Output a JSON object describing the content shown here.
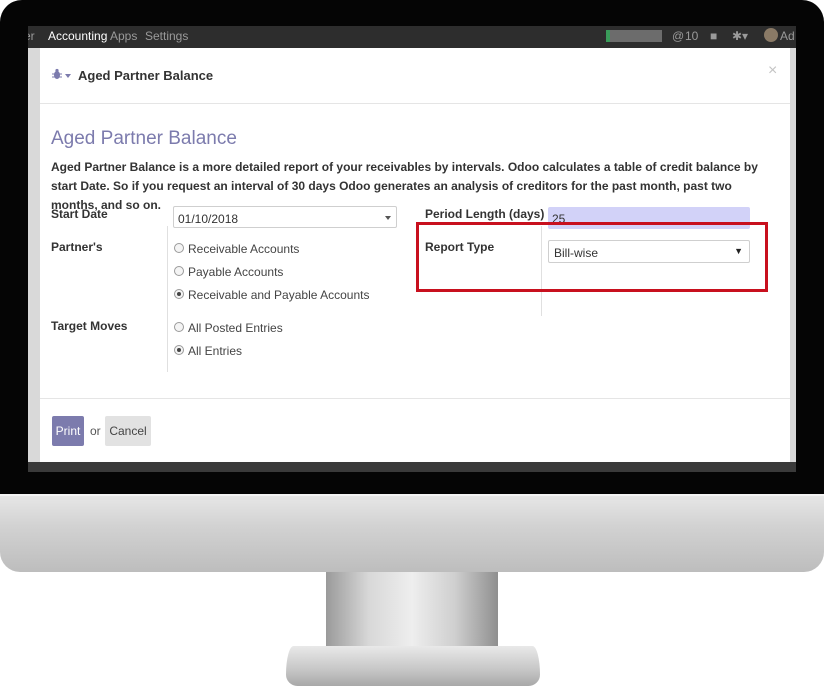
{
  "topbar": {
    "items": [
      "er",
      "Accounting",
      "Apps",
      "Settings"
    ],
    "message_count": "10",
    "user_short": "Ad"
  },
  "modal": {
    "header_title": "Aged Partner Balance",
    "close_label": "×"
  },
  "form": {
    "title": "Aged Partner Balance",
    "description": "Aged Partner Balance is a more detailed report of your receivables by intervals. Odoo calculates a table of credit balance by start Date. So if you request an interval of 30 days Odoo generates an analysis of creditors for the past month, past two months, and so on.",
    "start_date_label": "Start Date",
    "start_date_value": "01/10/2018",
    "partners_label": "Partner's",
    "partners_options": [
      "Receivable Accounts",
      "Payable Accounts",
      "Receivable and Payable Accounts"
    ],
    "partners_selected": 2,
    "target_moves_label": "Target Moves",
    "target_moves_options": [
      "All Posted Entries",
      "All Entries"
    ],
    "target_moves_selected": 1,
    "period_length_label": "Period Length (days)",
    "period_length_value": "25",
    "report_type_label": "Report Type",
    "report_type_value": "Bill-wise"
  },
  "footer": {
    "print_label": "Print",
    "or_label": "or",
    "cancel_label": "Cancel"
  },
  "colors": {
    "accent": "#7c7bad",
    "highlight": "#c8101e",
    "input_focus": "#d2d2f8"
  }
}
